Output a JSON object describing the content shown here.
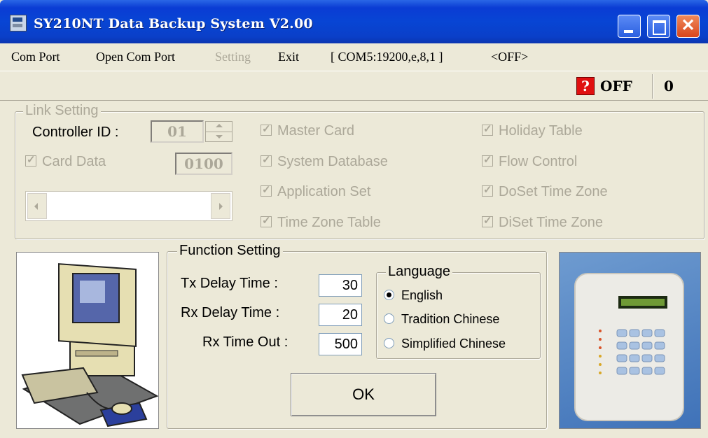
{
  "window": {
    "title": "SY210NT Data Backup System V2.00",
    "close_glyph": "✕"
  },
  "menu": {
    "com_port": "Com Port",
    "open_com_port": "Open Com Port",
    "setting": "Setting",
    "exit": "Exit",
    "port_info": "[ COM5:19200,e,8,1 ]",
    "state": "<OFF>"
  },
  "status": {
    "help_glyph": "?",
    "connection": "OFF",
    "count": "0"
  },
  "link_setting": {
    "title": "Link Setting",
    "controller_id_label": "Controller ID :",
    "controller_id_value": "01",
    "card_data_label": "Card Data",
    "card_data_value": "0100",
    "options": [
      "Master Card",
      "System Database",
      "Application Set",
      "Time Zone Table",
      "Holiday Table",
      "Flow Control",
      "DoSet Time Zone",
      "DiSet Time Zone"
    ]
  },
  "function_setting": {
    "title": "Function Setting",
    "tx_delay_label": "Tx Delay Time :",
    "tx_delay_value": "30",
    "rx_delay_label": "Rx Delay Time :",
    "rx_delay_value": "20",
    "rx_timeout_label": "Rx Time Out :",
    "rx_timeout_value": "500",
    "ok_label": "OK"
  },
  "language": {
    "title": "Language",
    "options": [
      "English",
      "Tradition Chinese",
      "Simplified Chinese"
    ],
    "selected": "English"
  }
}
